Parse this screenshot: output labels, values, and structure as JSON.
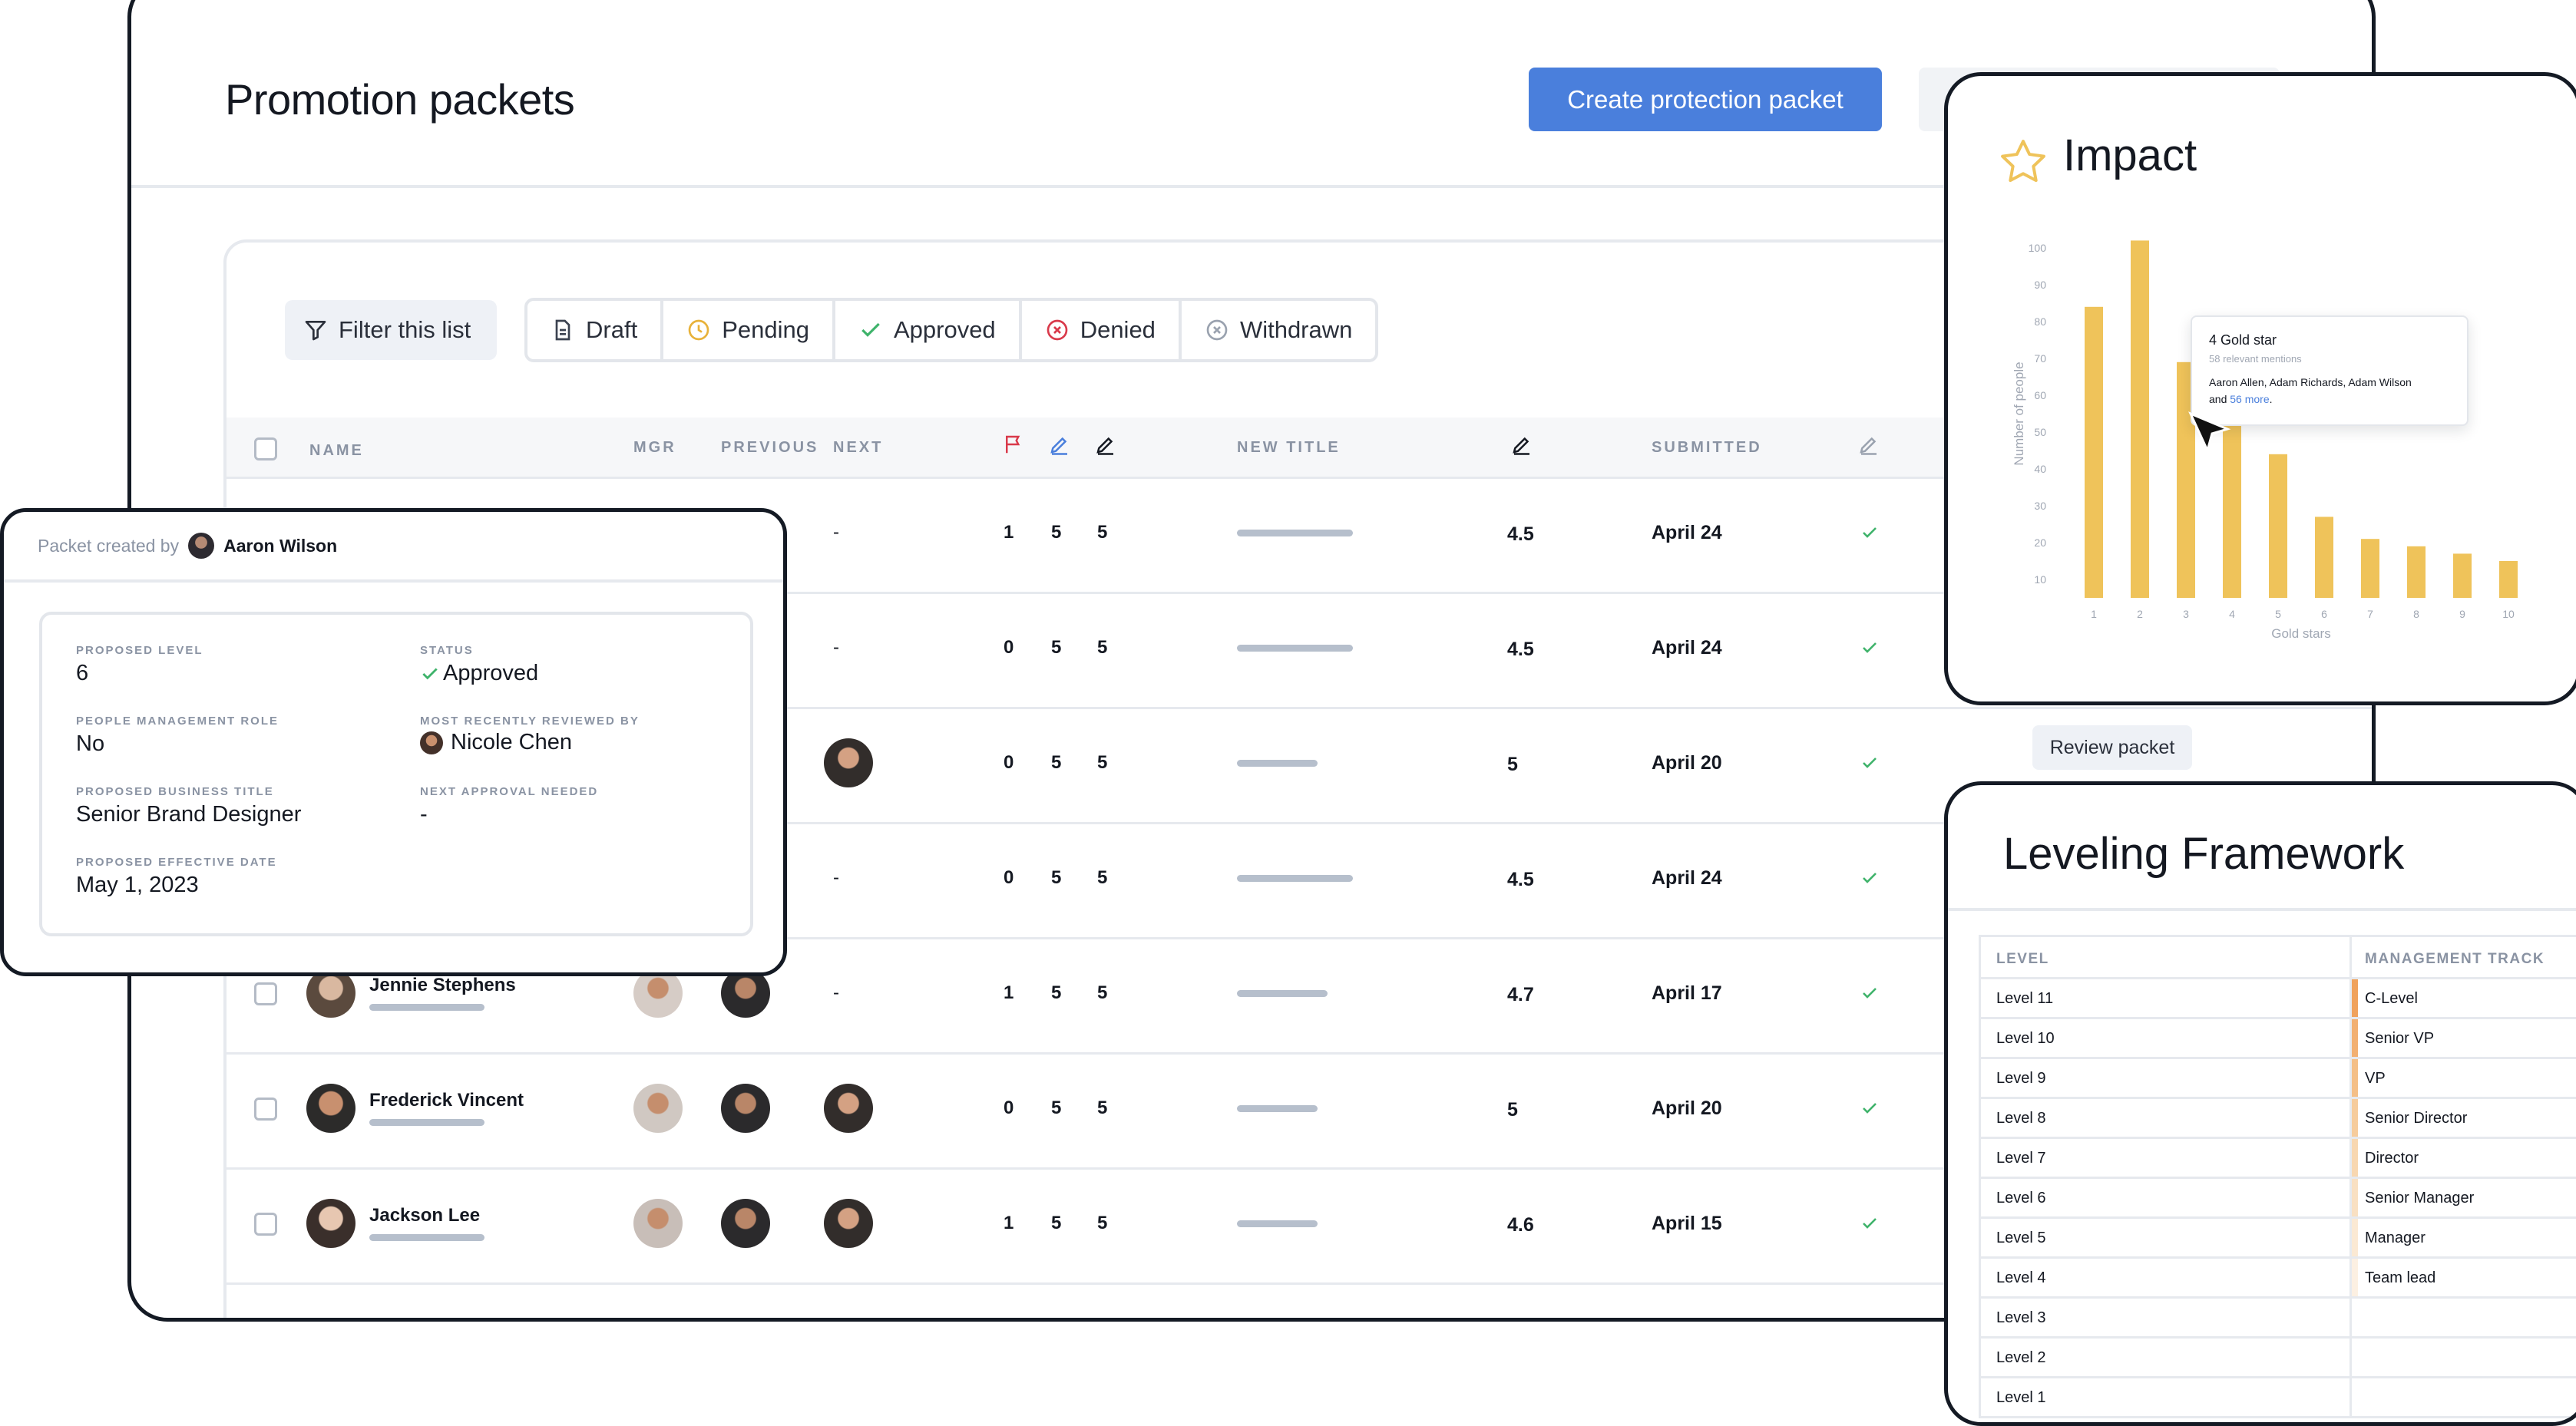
{
  "header": {
    "title": "Promotion packets",
    "primary_button": "Create protection packet"
  },
  "filters": {
    "filter_label": "Filter this list",
    "statuses": [
      "Draft",
      "Pending",
      "Approved",
      "Denied",
      "Withdrawn"
    ]
  },
  "table": {
    "columns": {
      "name": "NAME",
      "mgr": "MGR",
      "previous": "PREVIOUS",
      "next": "NEXT",
      "new_title": "NEW TITLE",
      "submitted": "SUBMITTED"
    },
    "rows": [
      {
        "name": "",
        "next": "-",
        "c1": "1",
        "c2": "5",
        "c3": "5",
        "score": "4.5",
        "date": "April 24",
        "bar": 0.72
      },
      {
        "name": "",
        "next": "-",
        "c1": "0",
        "c2": "5",
        "c3": "5",
        "score": "4.5",
        "date": "April 24",
        "bar": 0.72
      },
      {
        "name": "",
        "next": "",
        "c1": "0",
        "c2": "5",
        "c3": "5",
        "score": "5",
        "date": "April 20",
        "bar": 0.5
      },
      {
        "name": "",
        "next": "-",
        "c1": "0",
        "c2": "5",
        "c3": "5",
        "score": "4.5",
        "date": "April 24",
        "bar": 0.72
      },
      {
        "name": "Jennie Stephens",
        "next": "-",
        "c1": "1",
        "c2": "5",
        "c3": "5",
        "score": "4.7",
        "date": "April 17",
        "bar": 0.56
      },
      {
        "name": "Frederick Vincent",
        "next": "",
        "c1": "0",
        "c2": "5",
        "c3": "5",
        "score": "5",
        "date": "April 20",
        "bar": 0.5
      },
      {
        "name": "Jackson Lee",
        "next": "",
        "c1": "1",
        "c2": "5",
        "c3": "5",
        "score": "4.6",
        "date": "April 15",
        "bar": 0.5
      }
    ],
    "review_button": "Review packet"
  },
  "packet": {
    "created_by_label": "Packet created by",
    "created_by": "Aaron Wilson",
    "proposed_level_label": "PROPOSED LEVEL",
    "proposed_level": "6",
    "status_label": "STATUS",
    "status": "Approved",
    "people_mgmt_label": "PEOPLE MANAGEMENT ROLE",
    "people_mgmt": "No",
    "reviewed_by_label": "MOST RECENTLY REVIEWED BY",
    "reviewed_by": "Nicole Chen",
    "business_title_label": "PROPOSED BUSINESS TITLE",
    "business_title": "Senior Brand Designer",
    "next_approval_label": "NEXT APPROVAL NEEDED",
    "next_approval": "-",
    "effective_date_label": "PROPOSED EFFECTIVE DATE",
    "effective_date": "May 1, 2023"
  },
  "impact": {
    "title": "Impact",
    "tooltip": {
      "title": "4 Gold star",
      "subtitle": "58 relevant mentions",
      "names": "Aaron Allen, Adam Richards, Adam Wilson",
      "and": "and",
      "more": "56 more",
      "period": "."
    }
  },
  "chart_data": {
    "type": "bar",
    "title": "",
    "xlabel": "Gold stars",
    "ylabel": "Number of people",
    "categories": [
      "1",
      "2",
      "3",
      "4",
      "5",
      "6",
      "7",
      "8",
      "9",
      "10"
    ],
    "values": [
      84,
      102,
      69,
      53,
      44,
      27,
      21,
      19,
      17,
      15
    ],
    "yticks": [
      "10",
      "20",
      "30",
      "40",
      "50",
      "60",
      "70",
      "80",
      "90",
      "100"
    ],
    "ylim": [
      5,
      105
    ],
    "color": "#efc35a"
  },
  "leveling": {
    "title": "Leveling Framework",
    "col1": "LEVEL",
    "col2": "MANAGEMENT TRACK",
    "rows": [
      {
        "level": "Level 11",
        "track": "C-Level",
        "color": "#f0a25c"
      },
      {
        "level": "Level 10",
        "track": "Senior VP",
        "color": "#f2b072"
      },
      {
        "level": "Level 9",
        "track": "VP",
        "color": "#f4bf87"
      },
      {
        "level": "Level 8",
        "track": "Senior Director",
        "color": "#f6cc9c"
      },
      {
        "level": "Level 7",
        "track": "Director",
        "color": "#f8d7b0"
      },
      {
        "level": "Level 6",
        "track": "Senior Manager",
        "color": "#f9e0c2"
      },
      {
        "level": "Level 5",
        "track": "Manager",
        "color": "#fbe9d3"
      },
      {
        "level": "Level 4",
        "track": "Team lead",
        "color": "#fcf0e2"
      },
      {
        "level": "Level 3",
        "track": "",
        "color": ""
      },
      {
        "level": "Level 2",
        "track": "",
        "color": ""
      },
      {
        "level": "Level 1",
        "track": "",
        "color": ""
      }
    ]
  }
}
